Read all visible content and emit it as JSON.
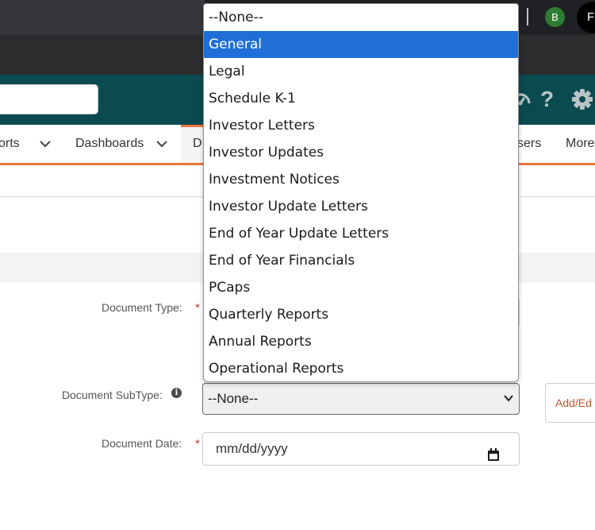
{
  "browser": {
    "profile_initial_1": "B",
    "profile_initial_2": "F"
  },
  "header": {
    "icons": [
      "dashboard-gauge-icon",
      "help-icon",
      "settings-gear-icon"
    ],
    "help_glyph": "?"
  },
  "nav": {
    "items": [
      {
        "label": "orts"
      },
      {
        "label": "Dashboards"
      },
      {
        "label": "D"
      },
      {
        "label": "sers"
      },
      {
        "label": "More"
      }
    ]
  },
  "form": {
    "document_type_label": "Document Type:",
    "document_subtype_label": "Document SubType:",
    "document_date_label": "Document Date:",
    "required_marker": "*",
    "subtype_value": "--None--",
    "date_placeholder": "mm/dd/yyyy",
    "add_edit_label": "Add/Ed",
    "info_glyph": "i"
  },
  "dropdown": {
    "selected_index": 1,
    "options": [
      "--None--",
      "General",
      "Legal",
      "Schedule K-1",
      "Investor Letters",
      "Investor Updates",
      "Investment Notices",
      "Investor Update Letters",
      "End of Year Update Letters",
      "End of Year Financials",
      "PCaps",
      "Quarterly Reports",
      "Annual Reports",
      "Operational Reports"
    ]
  },
  "colors": {
    "header_teal": "#0b4a4f",
    "accent_orange": "#e9773f",
    "selected_blue": "#1f6fd6",
    "required_red": "#c23934"
  }
}
